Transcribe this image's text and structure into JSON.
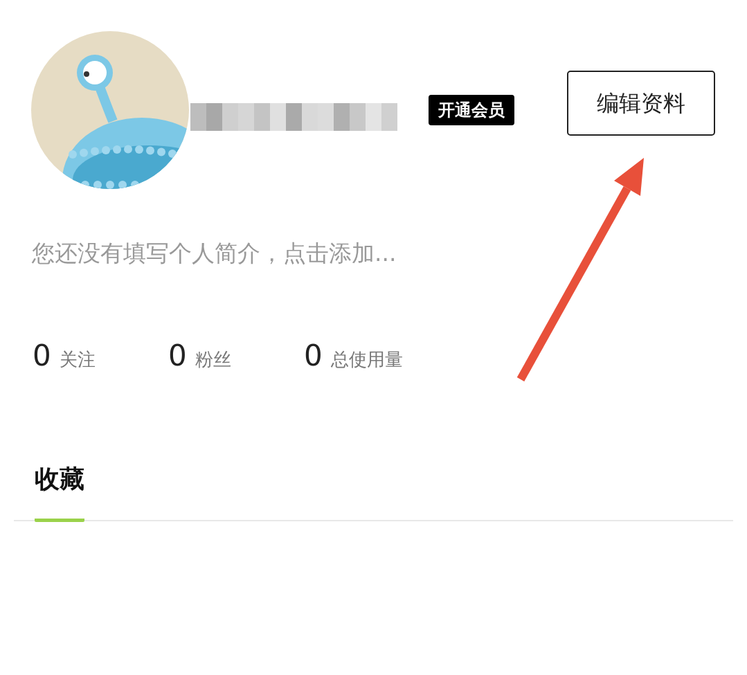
{
  "profile": {
    "username_redacted": true,
    "vip_badge": "开通会员",
    "edit_button": "编辑资料",
    "bio_placeholder": "您还没有填写个人简介，点击添加..."
  },
  "stats": [
    {
      "value": "0",
      "label": "关注"
    },
    {
      "value": "0",
      "label": "粉丝"
    },
    {
      "value": "0",
      "label": "总使用量"
    }
  ],
  "tabs": [
    {
      "label": "收藏",
      "selected": true
    }
  ],
  "annotation": {
    "kind": "arrow"
  }
}
